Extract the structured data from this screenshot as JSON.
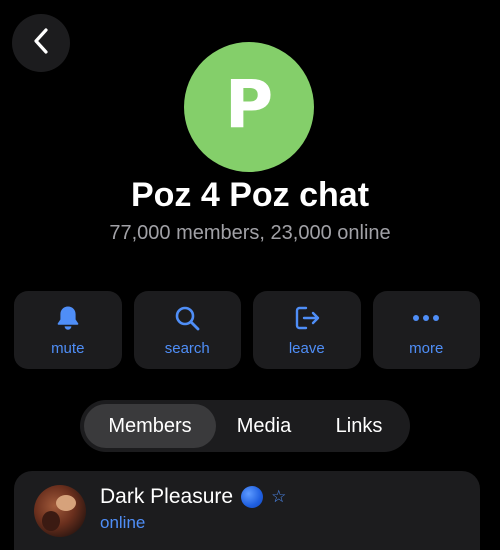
{
  "colors": {
    "accent": "#4f8ef7",
    "avatar_bg": "#84cf6a",
    "subtitle": "#a1a1a6"
  },
  "header": {
    "back_icon": "chevron-left-icon"
  },
  "chat": {
    "avatar_letter": "P",
    "title": "Poz 4 Poz chat",
    "subtitle": "77,000 members, 23,000 online"
  },
  "actions": [
    {
      "label": "mute",
      "icon": "bell-icon"
    },
    {
      "label": "search",
      "icon": "search-icon"
    },
    {
      "label": "leave",
      "icon": "leave-icon"
    },
    {
      "label": "more",
      "icon": "more-icon"
    }
  ],
  "tabs": [
    {
      "label": "Members",
      "active": true
    },
    {
      "label": "Media",
      "active": false
    },
    {
      "label": "Links",
      "active": false
    }
  ],
  "members": [
    {
      "name": "Dark Pleasure",
      "status": "online",
      "badge": "blue-circle",
      "star_icon": "star-icon"
    }
  ]
}
